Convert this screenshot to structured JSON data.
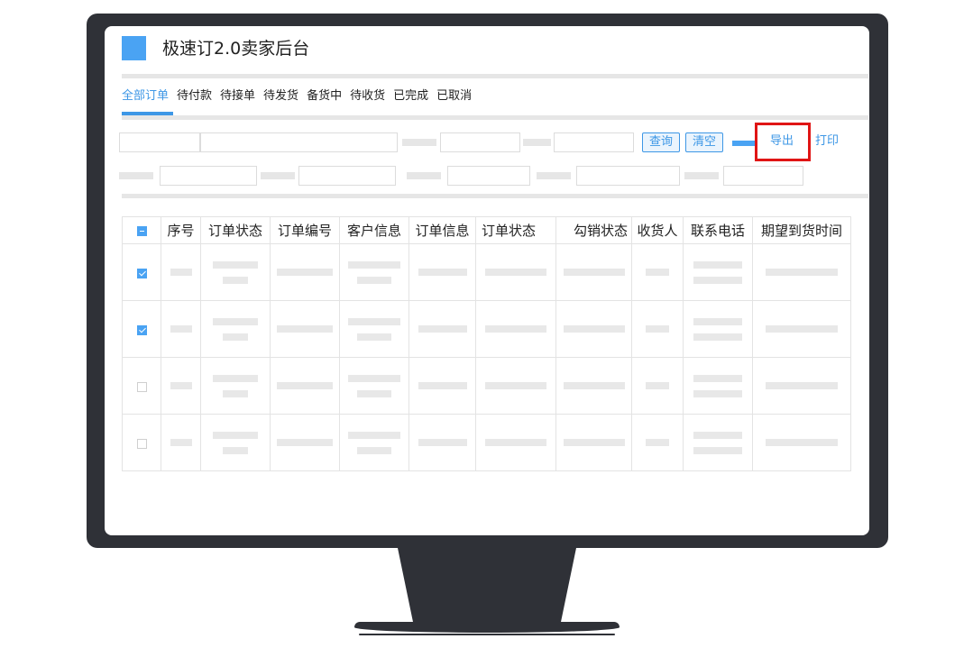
{
  "app": {
    "title": "极速订2.0卖家后台"
  },
  "tabs": [
    {
      "label": "全部订单",
      "active": true
    },
    {
      "label": "待付款"
    },
    {
      "label": "待接单"
    },
    {
      "label": "待发货"
    },
    {
      "label": "备货中"
    },
    {
      "label": "待收货"
    },
    {
      "label": "已完成"
    },
    {
      "label": "已取消"
    }
  ],
  "filters": {
    "query_label": "查询",
    "clear_label": "清空",
    "export_label": "导出",
    "print_label": "打印"
  },
  "table": {
    "select_all_state": "indeterminate",
    "headers": [
      "序号",
      "订单状态",
      "订单编号",
      "客户信息",
      "订单信息",
      "订单状态",
      "勾销状态",
      "收货人",
      "联系电话",
      "期望到货时间"
    ],
    "rows": [
      {
        "checked": true
      },
      {
        "checked": true
      },
      {
        "checked": false
      },
      {
        "checked": false
      }
    ]
  },
  "colors": {
    "accent": "#3d97e6",
    "highlight": "#e01515",
    "bezel": "#2f3137"
  }
}
